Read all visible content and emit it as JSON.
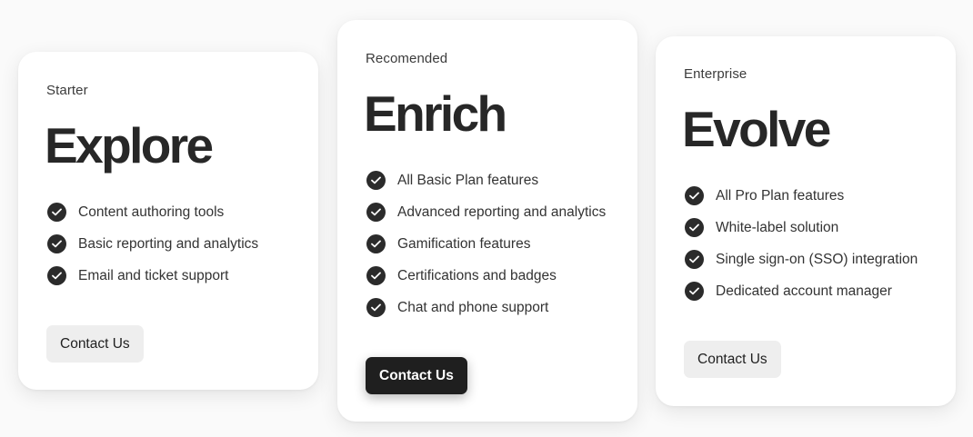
{
  "plans": [
    {
      "tier": "Starter",
      "name": "Explore",
      "features": [
        "Content authoring tools",
        "Basic reporting and analytics",
        "Email and ticket support"
      ],
      "cta_label": "Contact Us",
      "highlighted": false
    },
    {
      "tier": "Recomended",
      "name": "Enrich",
      "features": [
        "All Basic Plan features",
        "Advanced reporting and analytics",
        "Gamification features",
        "Certifications and badges",
        "Chat and phone support"
      ],
      "cta_label": "Contact Us",
      "highlighted": true
    },
    {
      "tier": "Enterprise",
      "name": "Evolve",
      "features": [
        "All Pro Plan features",
        "White-label solution",
        "Single sign-on (SSO) integration",
        "Dedicated account manager"
      ],
      "cta_label": "Contact Us",
      "highlighted": false
    }
  ],
  "icons": {
    "feature_bullet": "check-circle-icon"
  },
  "colors": {
    "background": "#fafafa",
    "card": "#ffffff",
    "text_primary": "#272727",
    "check_fill": "#2b2b2b",
    "button_light": "#eeeeee",
    "button_dark": "#1f1f1f"
  }
}
